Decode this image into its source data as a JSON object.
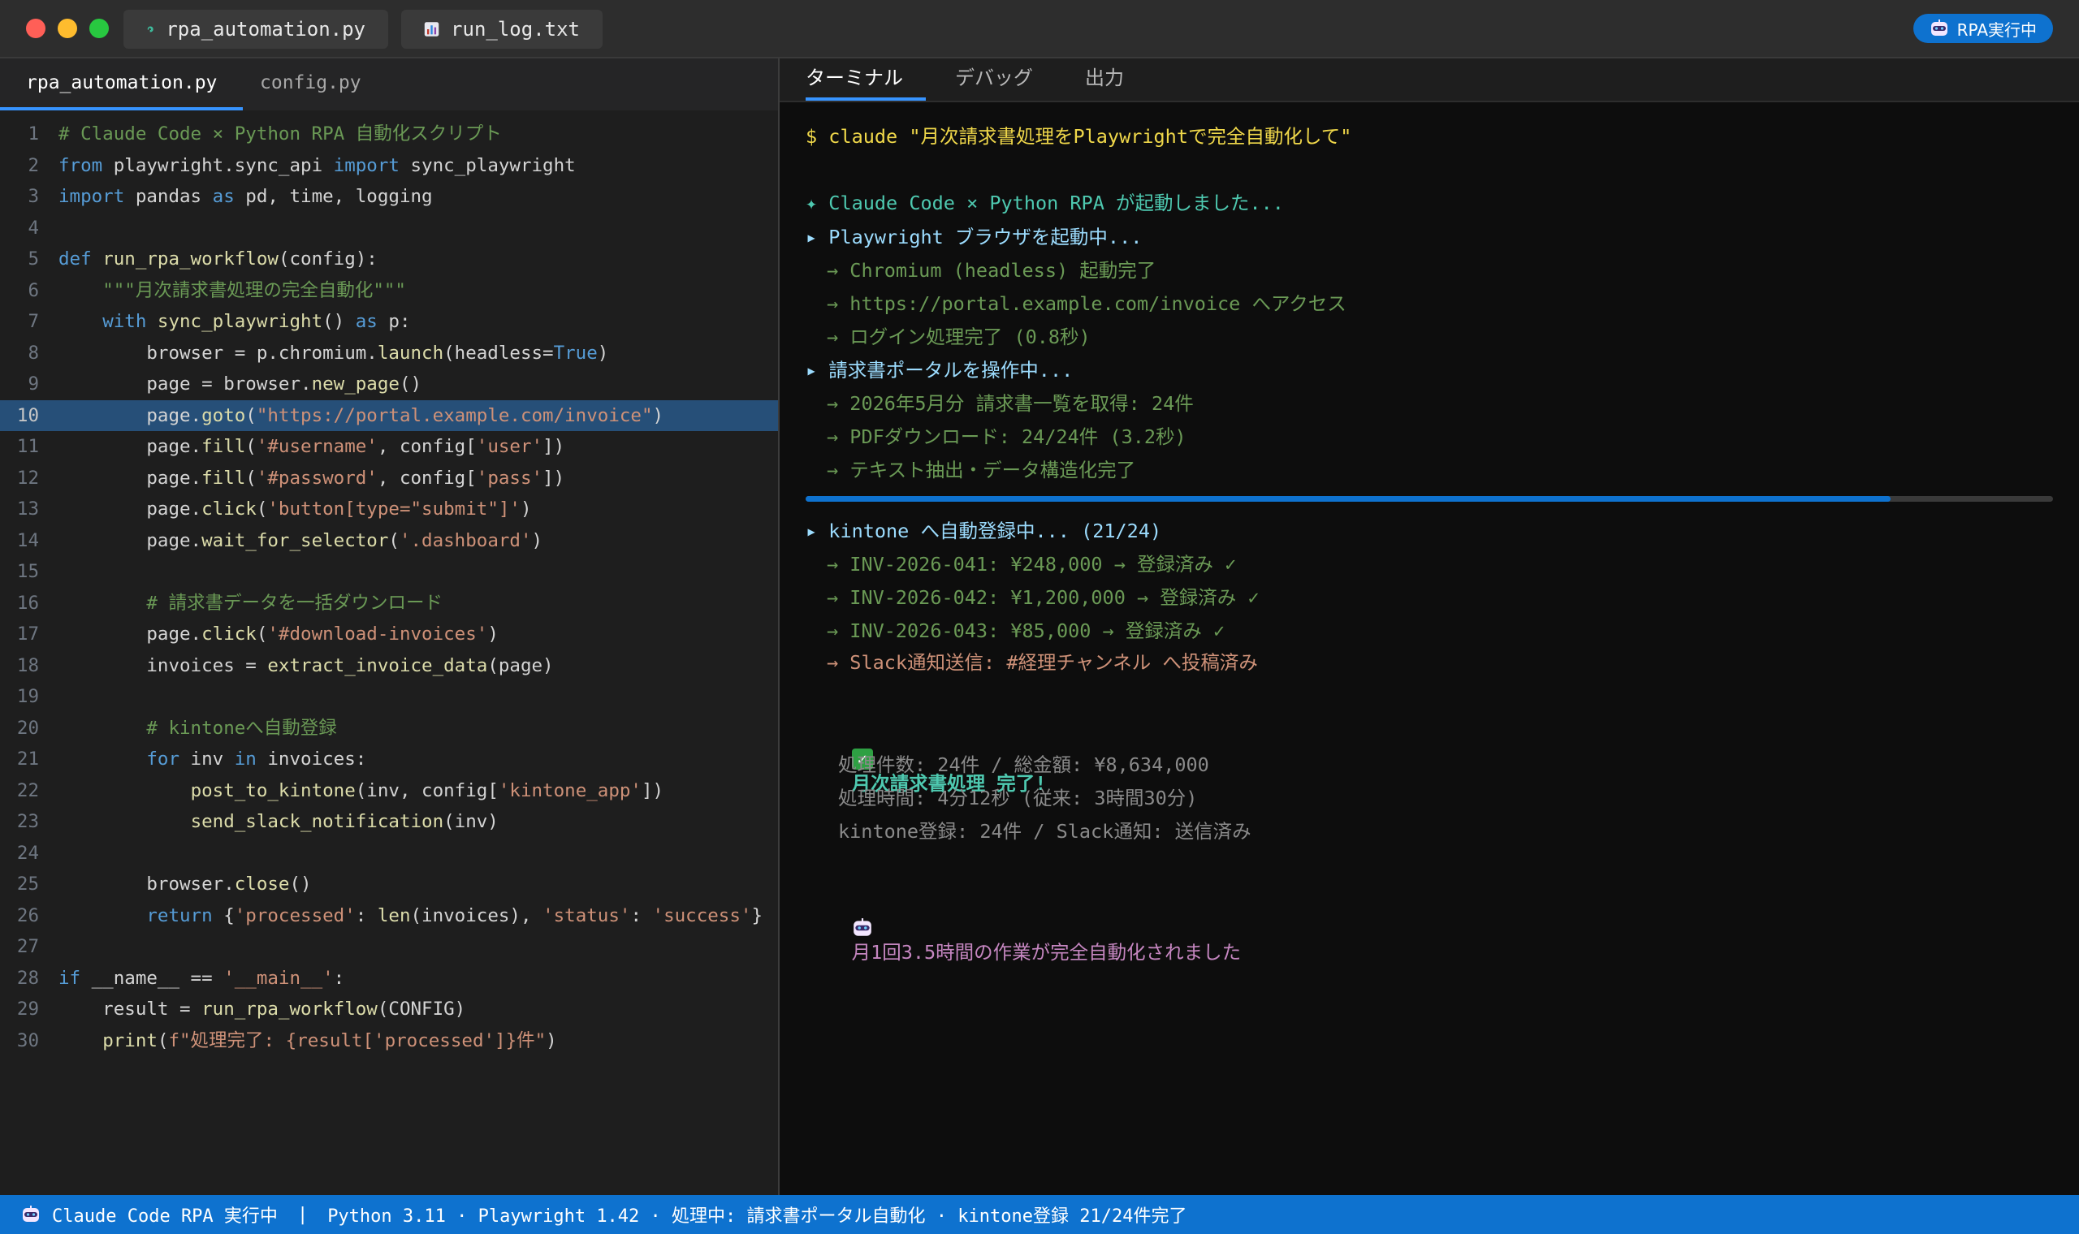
{
  "colors": {
    "accent": "#0e72cf",
    "close": "#ff5f57",
    "minimize": "#febc2e",
    "maximize": "#28c840"
  },
  "titlebar": {
    "tabs": [
      {
        "label": "rpa_automation.py",
        "icon": "python-file-icon"
      },
      {
        "label": "run_log.txt",
        "icon": "chart-log-icon"
      }
    ],
    "badge": "RPA実行中"
  },
  "editor": {
    "tabs": [
      {
        "label": "rpa_automation.py",
        "active": true
      },
      {
        "label": "config.py",
        "active": false
      }
    ],
    "highlighted_line": 10,
    "lines": [
      "# Claude Code × Python RPA 自動化スクリプト",
      "from playwright.sync_api import sync_playwright",
      "import pandas as pd, time, logging",
      "",
      "def run_rpa_workflow(config):",
      "    \"\"\"月次請求書処理の完全自動化\"\"\"",
      "    with sync_playwright() as p:",
      "        browser = p.chromium.launch(headless=True)",
      "        page = browser.new_page()",
      "        page.goto(\"https://portal.example.com/invoice\")",
      "        page.fill('#username', config['user'])",
      "        page.fill('#password', config['pass'])",
      "        page.click('button[type=\"submit\"]')",
      "        page.wait_for_selector('.dashboard')",
      "",
      "        # 請求書データを一括ダウンロード",
      "        page.click('#download-invoices')",
      "        invoices = extract_invoice_data(page)",
      "",
      "        # kintoneへ自動登録",
      "        for inv in invoices:",
      "            post_to_kintone(inv, config['kintone_app'])",
      "            send_slack_notification(inv)",
      "",
      "        browser.close()",
      "        return {'processed': len(invoices), 'status': 'success'}",
      "",
      "if __name__ == '__main__':",
      "    result = run_rpa_workflow(CONFIG)",
      "    print(f\"処理完了: {result['processed']}件\")"
    ]
  },
  "terminal": {
    "tabs": [
      "ターミナル",
      "デバッグ",
      "出力"
    ],
    "command": "$ claude \"月次請求書処理をPlaywrightで完全自動化して\"",
    "started": "✦ Claude Code × Python RPA が起動しました...",
    "step1": "▸ Playwright ブラウザを起動中...",
    "step1_items": [
      "→ Chromium (headless) 起動完了",
      "→ https://portal.example.com/invoice へアクセス",
      "→ ログイン処理完了 (0.8秒)"
    ],
    "step2": "▸ 請求書ポータルを操作中...",
    "step2_items": [
      "→ 2026年5月分 請求書一覧を取得: 24件",
      "→ PDFダウンロード: 24/24件 (3.2秒)",
      "→ テキスト抽出・データ構造化完了"
    ],
    "progress": 0.87,
    "step3": "▸ kintone へ自動登録中... (21/24)",
    "step3_items": [
      "→ INV-2026-041: ¥248,000 → 登録済み ✓",
      "→ INV-2026-042: ¥1,200,000 → 登録済み ✓",
      "→ INV-2026-043: ¥85,000 → 登録済み ✓"
    ],
    "slack": "→ Slack通知送信: #経理チャンネル へ投稿済み",
    "done_title": "月次請求書処理 完了!",
    "summary": [
      "処理件数: 24件 / 総金額: ¥8,634,000",
      "処理時間: 4分12秒 (従来: 3時間30分)",
      "kintone登録: 24件 / Slack通知: 送信済み"
    ],
    "final": "月1回3.5時間の作業が完全自動化されました"
  },
  "statusbar": {
    "left": "Claude Code RPA 実行中",
    "sep": "|",
    "right": "Python 3.11 · Playwright 1.42 · 処理中: 請求書ポータル自動化 · kintone登録 21/24件完了"
  }
}
